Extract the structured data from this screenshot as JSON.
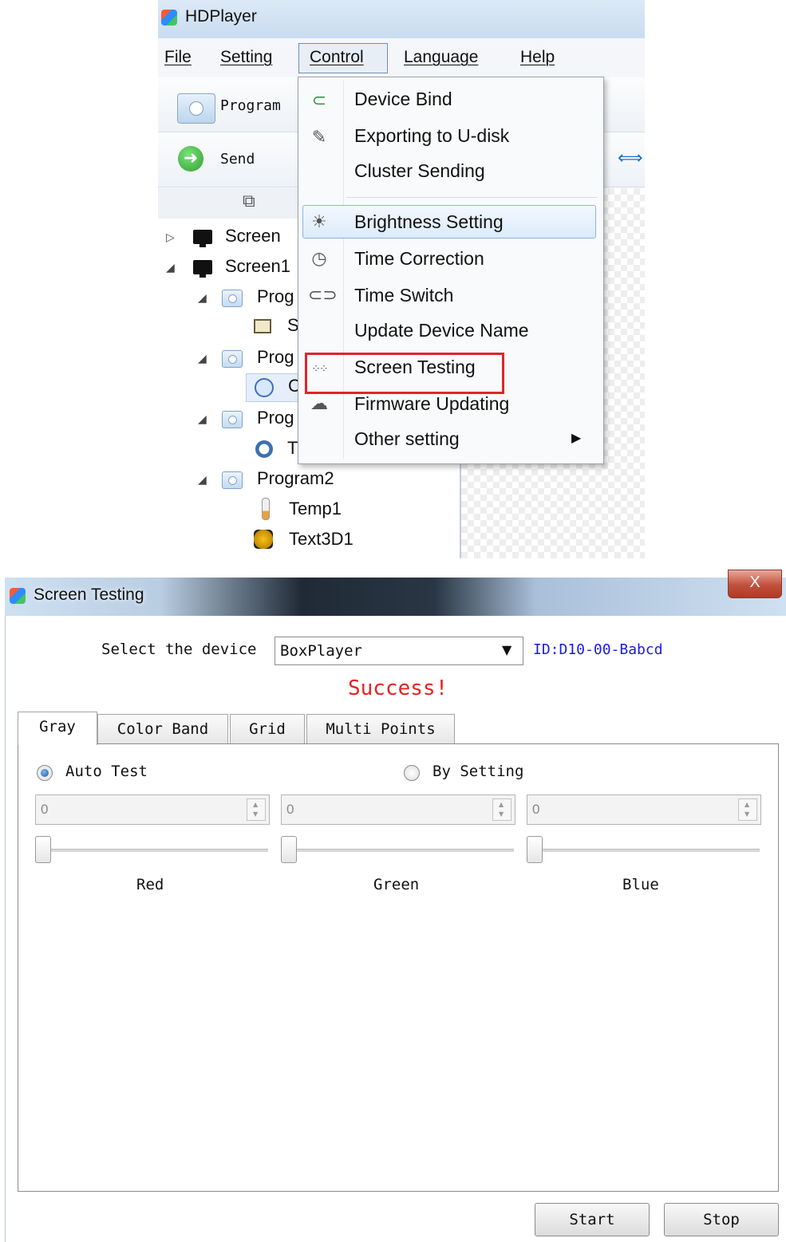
{
  "hdplayer": {
    "title": "HDPlayer",
    "menu": [
      "File",
      "Setting",
      "Control",
      "Language",
      "Help"
    ],
    "toolbar": {
      "program": "Program",
      "send": "Send"
    },
    "tree": {
      "screen": "Screen",
      "screen1": "Screen1",
      "prog": "Prog",
      "s_item": "S",
      "c_item": "C",
      "t_item": "T",
      "program2": "Program2",
      "temp1": "Temp1",
      "text3d1": "Text3D1"
    },
    "control_menu": {
      "items": [
        "Device Bind",
        "Exporting to U-disk",
        "Cluster Sending",
        "Brightness Setting",
        "Time Correction",
        "Time Switch",
        "Update Device Name",
        "Screen Testing",
        "Firmware Updating",
        "Other setting"
      ],
      "highlighted": "Brightness Setting",
      "boxed": "Screen Testing"
    }
  },
  "dialog": {
    "title": "Screen Testing",
    "close": "X",
    "select_label": "Select the device",
    "device": "BoxPlayer",
    "device_id": "ID:D10-00-Babcd",
    "status": "Success!",
    "status_color": "#e42424",
    "tabs": [
      "Gray",
      "Color Band",
      "Grid",
      "Multi Points"
    ],
    "active_tab": "Gray",
    "mode_auto": "Auto Test",
    "mode_setting": "By Setting",
    "selected_mode": "Auto Test",
    "channels": [
      {
        "label": "Red",
        "value": "0",
        "slider": 0
      },
      {
        "label": "Green",
        "value": "0",
        "slider": 0
      },
      {
        "label": "Blue",
        "value": "0",
        "slider": 0
      }
    ],
    "buttons": {
      "start": "Start",
      "stop": "Stop"
    }
  }
}
